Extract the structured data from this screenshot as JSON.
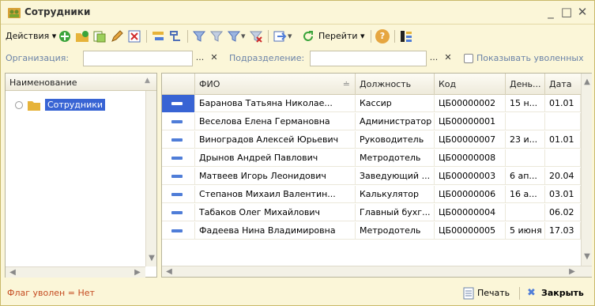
{
  "window": {
    "title": "Сотрудники",
    "minimize": "_",
    "maximize": "□",
    "close": "✕"
  },
  "toolbar": {
    "actions_label": "Действия",
    "goto_label": "Перейти",
    "dropdown_glyph": "▾",
    "help_glyph": "?"
  },
  "filter": {
    "org_label": "Организация:",
    "org_value": "",
    "dept_label": "Подразделение:",
    "dept_value": "",
    "dots": "...",
    "clear": "✕",
    "show_fired_label": "Показывать уволенных"
  },
  "tree": {
    "header": "Наименование",
    "items": [
      {
        "label": "Сотрудники"
      }
    ]
  },
  "grid": {
    "columns": [
      "ФИО",
      "Должность",
      "Код",
      "День...",
      "Дата"
    ],
    "sort_glyph": "≐",
    "rows": [
      {
        "fio": "Баранова Татьяна Николае...",
        "position": "Кассир",
        "code": "ЦБ00000002",
        "day": "15 н...",
        "date": "01.01"
      },
      {
        "fio": "Веселова Елена Германовна",
        "position": "Администратор",
        "code": "ЦБ00000001",
        "day": "",
        "date": ""
      },
      {
        "fio": "Виноградов Алексей Юрьевич",
        "position": "Руководитель",
        "code": "ЦБ00000007",
        "day": "23 и...",
        "date": "01.01"
      },
      {
        "fio": "Дрынов Андрей Павлович",
        "position": "Метродотель",
        "code": "ЦБ00000008",
        "day": "",
        "date": ""
      },
      {
        "fio": "Матвеев Игорь Леонидович",
        "position": "Заведующий ...",
        "code": "ЦБ00000003",
        "day": "6 ап...",
        "date": "20.04"
      },
      {
        "fio": "Степанов Михаил Валентин...",
        "position": "Калькулятор",
        "code": "ЦБ00000006",
        "day": "16 а...",
        "date": "03.01"
      },
      {
        "fio": "Табаков Олег Михайлович",
        "position": "Главный бухг...",
        "code": "ЦБ00000004",
        "day": "",
        "date": "06.02"
      },
      {
        "fio": "Фадеева Нина Владимировна",
        "position": "Метродотель",
        "code": "ЦБ00000005",
        "day": "5 июня",
        "date": "17.03"
      }
    ]
  },
  "footer": {
    "flag_text": "Флаг уволен = Нет",
    "print_label": "Печать",
    "close_label": "Закрыть"
  },
  "colors": {
    "accent": "#3864d4",
    "flag": "#c44a1f",
    "label": "#6b83a8"
  }
}
